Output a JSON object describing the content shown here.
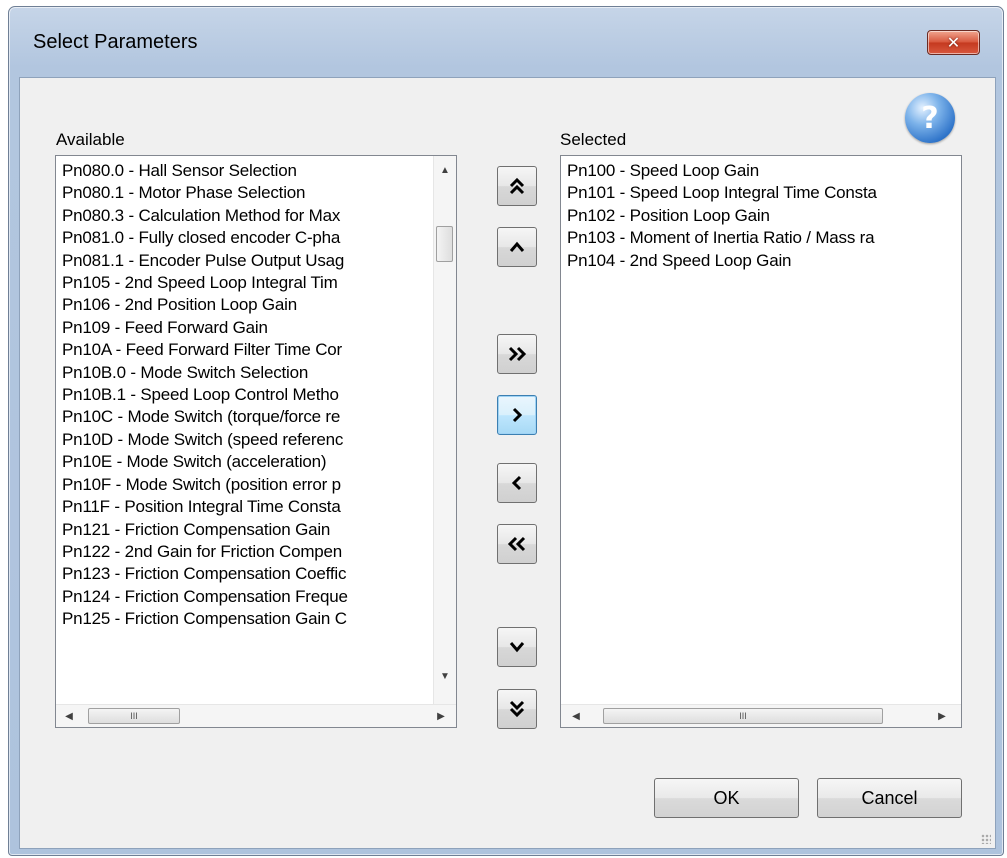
{
  "window": {
    "title": "Select Parameters",
    "close_glyph": "✕"
  },
  "help": {
    "icon": "help-icon",
    "glyph": "?"
  },
  "available": {
    "label": "Available",
    "items": [
      "Pn080.0 - Hall Sensor Selection",
      "Pn080.1 - Motor Phase Selection",
      "Pn080.3 - Calculation Method for Max",
      "Pn081.0 - Fully closed encoder C-pha",
      "Pn081.1 - Encoder Pulse Output Usag",
      "Pn105 - 2nd Speed Loop Integral Tim",
      "Pn106 - 2nd Position Loop Gain",
      "Pn109 - Feed Forward Gain",
      "Pn10A - Feed Forward Filter Time Cor",
      "Pn10B.0 - Mode Switch Selection",
      "Pn10B.1 - Speed Loop Control Metho",
      "Pn10C - Mode Switch (torque/force re",
      "Pn10D - Mode Switch (speed referenc",
      "Pn10E - Mode Switch (acceleration)",
      "Pn10F - Mode Switch (position error p",
      "Pn11F - Position Integral Time Consta",
      "Pn121 - Friction Compensation Gain",
      "Pn122 - 2nd Gain for Friction Compen",
      "Pn123 - Friction Compensation Coeffic",
      "Pn124 - Friction Compensation Freque",
      "Pn125 - Friction Compensation Gain C"
    ]
  },
  "selected": {
    "label": "Selected",
    "items": [
      "Pn100 - Speed Loop Gain",
      "Pn101 - Speed Loop Integral Time Consta",
      "Pn102 - Position Loop Gain",
      "Pn103 - Moment of Inertia Ratio / Mass ra",
      "Pn104 - 2nd Speed Loop Gain"
    ]
  },
  "move_buttons": {
    "move_top": "⌃⌃",
    "move_up": "⌃",
    "add_all": "»",
    "add": "›",
    "remove": "‹",
    "remove_all": "«",
    "move_down": "⌄",
    "move_bottom": "⌄⌄"
  },
  "scroll": {
    "thumb_grip": "III",
    "left_arrow": "◀",
    "right_arrow": "▶",
    "up_arrow": "▲",
    "down_arrow": "▼"
  },
  "buttons": {
    "ok": "OK",
    "cancel": "Cancel"
  }
}
